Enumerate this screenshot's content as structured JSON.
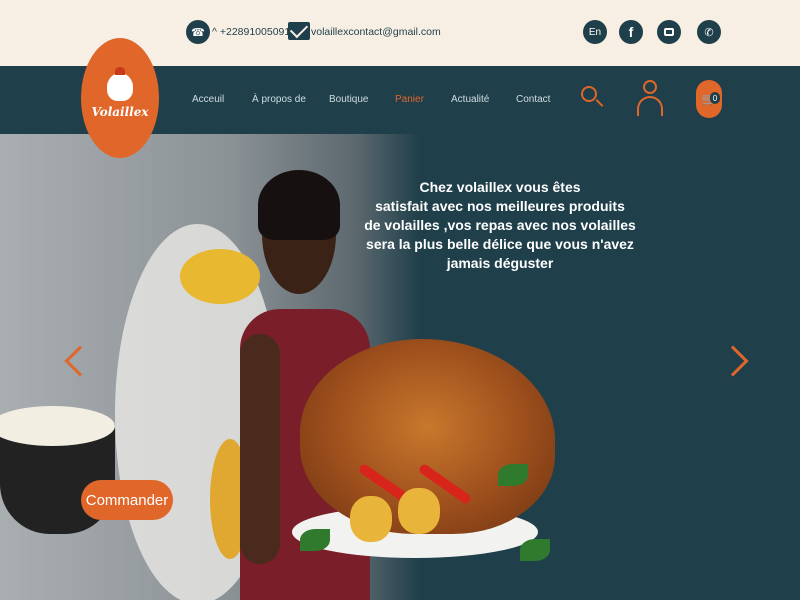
{
  "contact": {
    "phone": "^ +22891005091",
    "email": "volaillexcontact@gmail.com"
  },
  "social": {
    "lang_label": "En",
    "facebook_label": "f"
  },
  "brand": {
    "logo_text": "Volaillex",
    "accent_color": "#e0662a",
    "dark_color": "#1f3f4a",
    "cream_color": "#f7eee4"
  },
  "nav": {
    "items": [
      {
        "label": "Acceuil"
      },
      {
        "label": "À propos de"
      },
      {
        "label": "Boutique"
      },
      {
        "label": "Panier"
      },
      {
        "label": "Actualité"
      },
      {
        "label": "Contact"
      }
    ],
    "active_index": 3,
    "cart_count": "0"
  },
  "hero": {
    "headline_lines": [
      "Chez volaillex vous êtes",
      "satisfait avec nos meilleures produits",
      "de volailles ,vos repas avec nos volailles",
      "sera la plus belle délice que vous n'avez",
      "jamais déguster"
    ],
    "cta_label": "Commander"
  }
}
